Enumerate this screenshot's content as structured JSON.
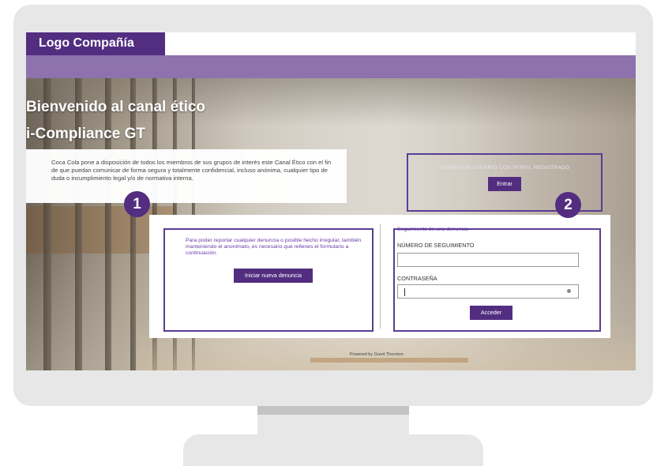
{
  "header": {
    "logo_text": "Logo Compañía"
  },
  "hero": {
    "title_line1": "Bienvenido al canal ético",
    "title_line2": "i-Compliance GT",
    "intro_text": "Coca Cola pone a disposición de todos los miembros de sus grupos de interés este Canal Ético con el fin de que puedan comunicar de forma segura y totalmente confidencial, incluso anónima, cualquier tipo de duda o incumplimiento legal y/o de normativa interna."
  },
  "registered": {
    "text": "SI ERES UN USUARIO CON PERFIL REGISTRADO",
    "button_label": "Entrar"
  },
  "new_report": {
    "text": "Para poder reportar cualquier denuncia o posible hecho irregular, también manteniendo el anonimato, es necesario que rellenes el formulario a continuación.",
    "button_label": "Iniciar nueva denuncia"
  },
  "tracking": {
    "title": "Seguimiento de una denuncia",
    "number_label": "NÚMERO DE SEGUIMIENTO",
    "password_label": "CONTRASEÑA",
    "button_label": "Acceder"
  },
  "badges": {
    "one": "1",
    "two": "2"
  },
  "footer": {
    "powered_text": "Powered by Grant Thornton"
  },
  "colors": {
    "brand_purple": "#522d80",
    "band_purple": "#8d72ad",
    "outline_purple": "#5a3d95"
  },
  "icons": {
    "password_toggle": "eye-icon"
  }
}
